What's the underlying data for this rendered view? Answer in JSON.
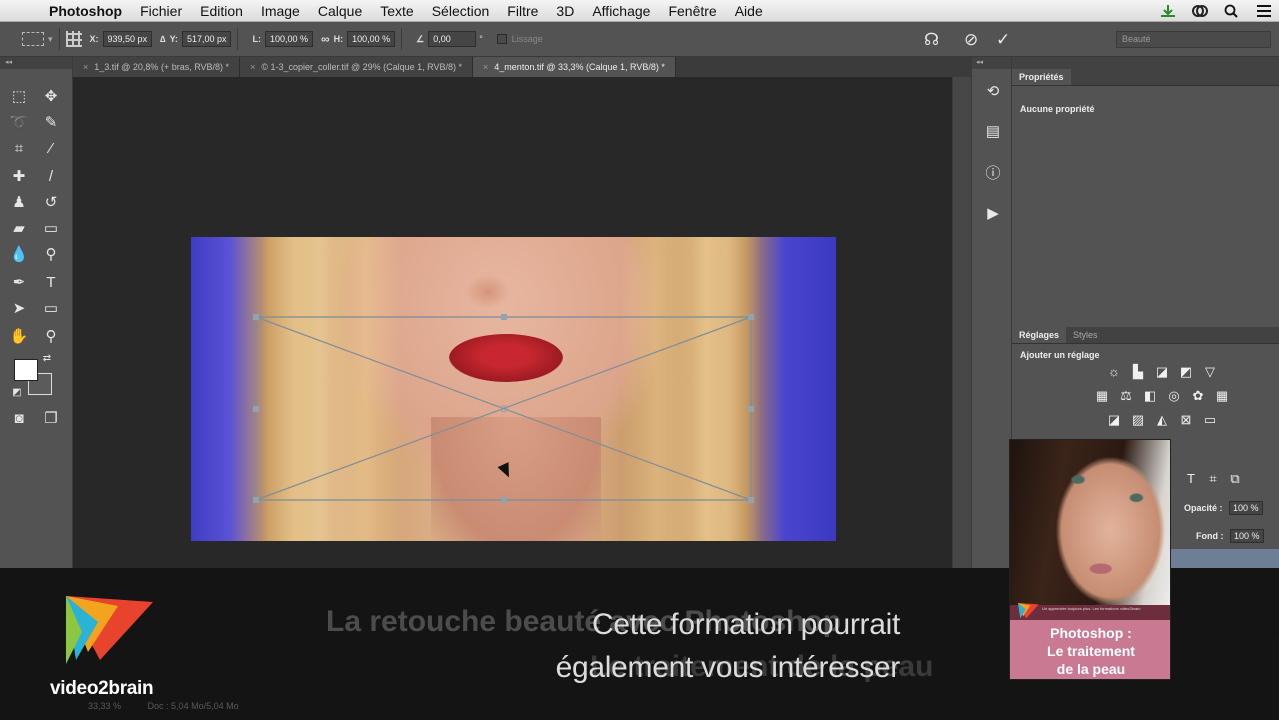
{
  "menubar": {
    "app": "Photoshop",
    "items": [
      "Fichier",
      "Edition",
      "Image",
      "Calque",
      "Texte",
      "Sélection",
      "Filtre",
      "3D",
      "Affichage",
      "Fenêtre",
      "Aide"
    ]
  },
  "options": {
    "x_label": "X:",
    "x_value": "939,50 px",
    "y_label": "Y:",
    "y_value": "517,00 px",
    "w_label": "L:",
    "w_value": "100,00 %",
    "h_label": "H:",
    "h_value": "100,00 %",
    "angle_value": "0,00",
    "angle_unit": "°",
    "smoothing_label": "Lissage",
    "workspace": "Beauté"
  },
  "tabs": [
    {
      "label": "1_3.tif @ 20,8% (+ bras, RVB/8) *"
    },
    {
      "label": "© 1-3_copier_coller.tif @ 29% (Calque 1, RVB/8) *"
    },
    {
      "label": "4_menton.tif @ 33,3% (Calque 1, RVB/8) *"
    }
  ],
  "properties": {
    "tab": "Propriétés",
    "empty": "Aucune propriété"
  },
  "adjustments": {
    "tabs": [
      "Réglages",
      "Styles"
    ],
    "title": "Ajouter un réglage"
  },
  "layers": {
    "opacity_label": "Opacité :",
    "opacity_value": "100 %",
    "fill_label": "Fond :",
    "fill_value": "100 %"
  },
  "status": {
    "zoom": "33,33 %",
    "doc": "Doc : 5,04 Mo/5,04 Mo"
  },
  "overlay": {
    "logo_text": "video2brain",
    "ghost_line1": "La retouche beauté avec Photoshop",
    "ghost_line2": "Le traitement de la peau",
    "caption_line1": "Cette formation pourrait",
    "caption_line2": "également vous intéresser"
  },
  "promo": {
    "tagline": "Un apprendre toujours plus. Les formations video2brain",
    "title_line1": "Photoshop :",
    "title_line2": "Le traitement",
    "title_line3": "de la peau"
  },
  "colors": {
    "panel": "#535353",
    "canvas_bg": "#282828",
    "promo_pink": "#c97a92"
  }
}
